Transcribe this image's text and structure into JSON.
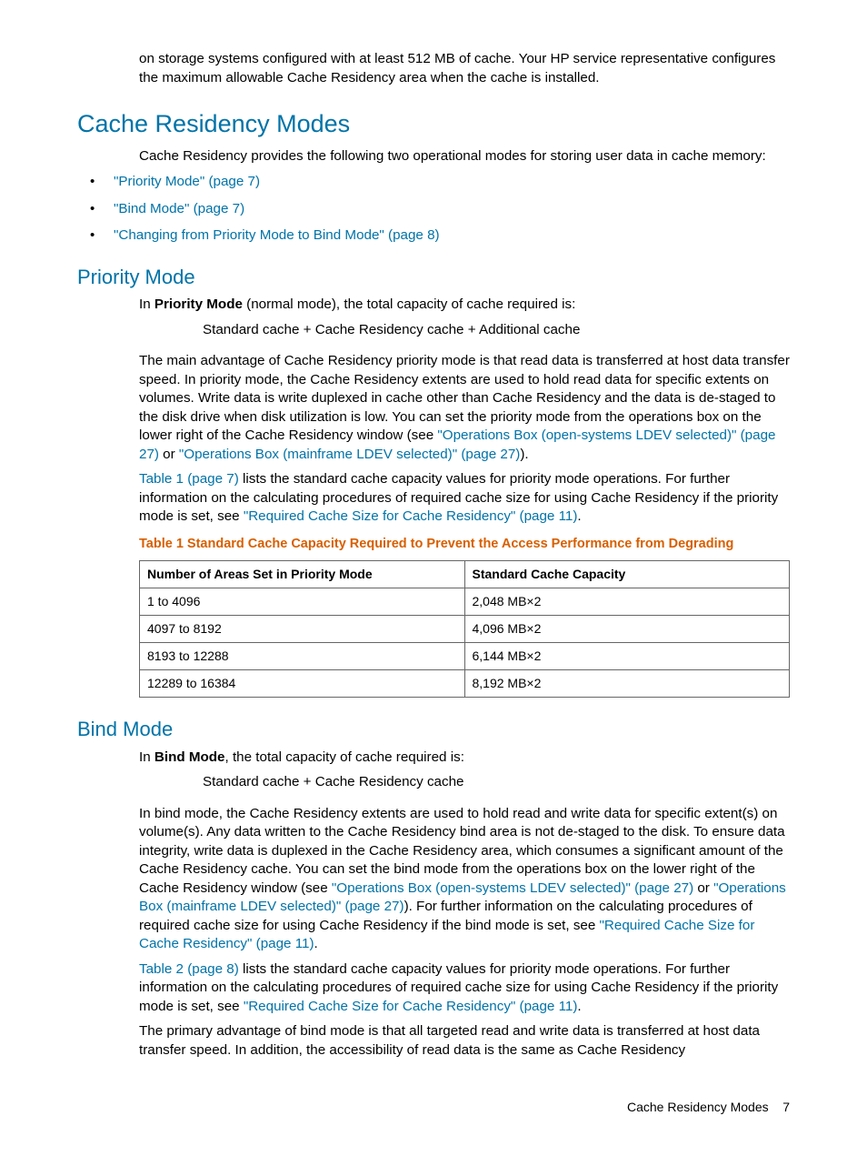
{
  "intro_p1_a": "on storage systems configured with at least 512 MB of cache. Your HP service representative configures the maximum allowable Cache Residency area when the cache is installed.",
  "h1": "Cache Residency Modes",
  "intro_modes": "Cache Residency provides the following two operational modes for storing user data in cache memory:",
  "modes": [
    "\"Priority Mode\" (page 7)",
    "\"Bind Mode\" (page 7)",
    "\"Changing from Priority Mode to Bind Mode\" (page 8)"
  ],
  "h2_priority": "Priority Mode",
  "priority": {
    "p1_a": "In ",
    "p1_b": "Priority Mode",
    "p1_c": " (normal mode), the total capacity of cache required is:",
    "formula": "Standard cache + Cache Residency cache + Additional cache",
    "p2_a": "The main advantage of Cache Residency priority mode is that read data is transferred at host data transfer speed. In priority mode, the Cache Residency extents are used to hold read data for specific extents on volumes. Write data is write duplexed in cache other than Cache Residency and the data is de-staged to the disk drive when disk utilization is low. You can set the priority mode from the operations box on the lower right of the Cache Residency window (see ",
    "p2_link1": "\"Operations Box (open-systems LDEV selected)\" (page 27)",
    "p2_b": " or ",
    "p2_link2": "\"Operations Box (mainframe LDEV selected)\" (page 27)",
    "p2_c": ").",
    "p3_link1": "Table 1 (page 7)",
    "p3_a": " lists the standard cache capacity values for priority mode operations. For further information on the calculating procedures of required cache size for using Cache Residency if the priority mode is set, see ",
    "p3_link2": "\"Required Cache Size for Cache Residency\" (page 11)",
    "p3_b": "."
  },
  "table1": {
    "caption": "Table 1 Standard Cache Capacity Required to Prevent the Access Performance from Degrading",
    "headers": [
      "Number of Areas Set in Priority Mode",
      "Standard Cache Capacity"
    ],
    "rows": [
      [
        "1 to 4096",
        "2,048 MB×2"
      ],
      [
        "4097 to 8192",
        "4,096 MB×2"
      ],
      [
        "8193 to 12288",
        "6,144 MB×2"
      ],
      [
        "12289 to 16384",
        "8,192 MB×2"
      ]
    ]
  },
  "h2_bind": "Bind Mode",
  "bind": {
    "p1_a": "In ",
    "p1_b": "Bind Mode",
    "p1_c": ", the total capacity of cache required is:",
    "formula": "Standard cache + Cache Residency cache",
    "p2_a": "In bind mode, the Cache Residency extents are used to hold read and write data for specific extent(s) on volume(s). Any data written to the Cache Residency bind area is not de-staged to the disk. To ensure data integrity, write data is duplexed in the Cache Residency area, which consumes a significant amount of the Cache Residency cache. You can set the bind mode from the operations box on the lower right of the Cache Residency window (see ",
    "p2_link1": "\"Operations Box (open-systems LDEV selected)\" (page 27)",
    "p2_b": " or ",
    "p2_link2": "\"Operations Box (mainframe LDEV selected)\" (page 27)",
    "p2_c": "). For further information on the calculating procedures of required cache size for using Cache Residency if the bind mode is set, see ",
    "p2_link3": "\"Required Cache Size for Cache Residency\" (page 11)",
    "p2_d": ".",
    "p3_link1": "Table 2 (page 8)",
    "p3_a": " lists the standard cache capacity values for priority mode operations. For further information on the calculating procedures of required cache size for using Cache Residency if the priority mode is set, see ",
    "p3_link2": "\"Required Cache Size for Cache Residency\" (page 11)",
    "p3_b": ".",
    "p4": "The primary advantage of bind mode is that all targeted read and write data is transferred at host data transfer speed. In addition, the accessibility of read data is the same as Cache Residency"
  },
  "footer": {
    "section": "Cache Residency Modes",
    "page": "7"
  }
}
